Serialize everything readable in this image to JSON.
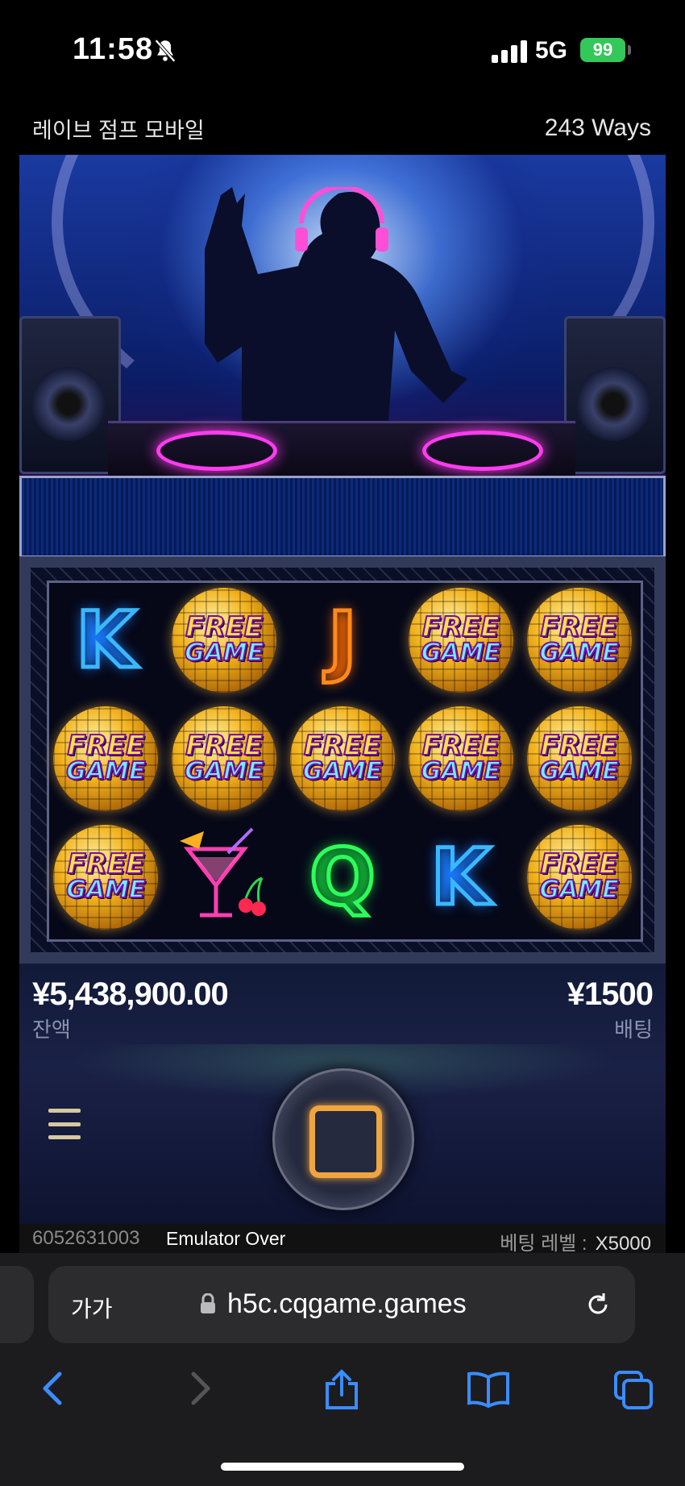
{
  "status_bar": {
    "time": "11:58",
    "network": "5G",
    "battery": "99"
  },
  "game": {
    "title": "레이브 점프 모바일",
    "ways": "243 Ways"
  },
  "reels": [
    [
      "K",
      "FREE_GAME",
      "J",
      "FREE_GAME",
      "FREE_GAME"
    ],
    [
      "FREE_GAME",
      "FREE_GAME",
      "FREE_GAME",
      "FREE_GAME",
      "FREE_GAME"
    ],
    [
      "FREE_GAME",
      "COCKTAIL",
      "Q",
      "K",
      "FREE_GAME"
    ]
  ],
  "symbol_text": {
    "free": "FREE",
    "game": "GAME"
  },
  "panel": {
    "balance": "¥5,438,900.00",
    "balance_label": "잔액",
    "bet": "¥1500",
    "bet_label": "배팅"
  },
  "info_bar": {
    "account": "6052631003",
    "emulator": "Emulator Over",
    "bet_level_label": "베팅 레벨 :",
    "bet_level_value": "X5000"
  },
  "browser": {
    "text_size_label": "가가",
    "url": "h5c.cqgame.games"
  },
  "icons": [
    "bell-slash-icon",
    "signal-icon",
    "lock-icon",
    "reload-icon",
    "back-icon",
    "forward-icon",
    "share-icon",
    "bookmarks-icon",
    "tabs-icon",
    "menu-icon",
    "stop-icon"
  ]
}
